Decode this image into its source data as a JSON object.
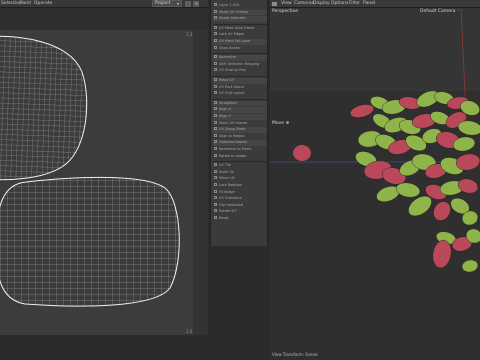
{
  "uv_editor": {
    "menu": [
      "Selection",
      "Paint",
      "Operate"
    ],
    "project_dropdown": "Project",
    "buttons": [
      "▢",
      "⊞"
    ],
    "axis_tick_top": "1,1",
    "axis_tick_bottom": "1,0"
  },
  "tool_panel": {
    "items": [
      "Layer 1 UVs",
      "Show UV Overlay",
      "Shade Selected",
      "",
      "UV Mesh Auto Frame",
      "Lock UV Edges",
      "UV Mesh Sel Layer",
      "Show Border",
      "",
      "Normalize",
      "Shift Selection Mapping",
      "UV Unwrap Pins",
      "",
      "Relax UV",
      "UV Pack Island",
      "UV Grid Layout",
      "",
      "Straighten",
      "Align U",
      "Align V",
      "Stack UV Islands",
      "UV Group Mode",
      "Align to Region",
      "Optimize Islands",
      "Normalize to Pixels",
      "Rotate to Image",
      "",
      "UV Tile",
      "Scale UV",
      "Mirror UV",
      "Lock Rotation",
      "Fit Image",
      "UV Transform",
      "Flip Horizontal",
      "Rotate 90°",
      "Reset"
    ]
  },
  "viewport": {
    "menu": [
      "View",
      "Cameras",
      "Display",
      "Options",
      "Filter",
      "Panel"
    ],
    "mode_label": "Perspective",
    "camera_label": "Default Camera",
    "camera_suffix": "◦",
    "move_label": "Move",
    "status_text": "View Transform: Scene"
  },
  "colors": {
    "uv_bg": "#3c3c3c",
    "viewport_bg": "#2f2f2f",
    "pistachio_green": "#8fb54a",
    "pistachio_pink": "#b8485a"
  }
}
